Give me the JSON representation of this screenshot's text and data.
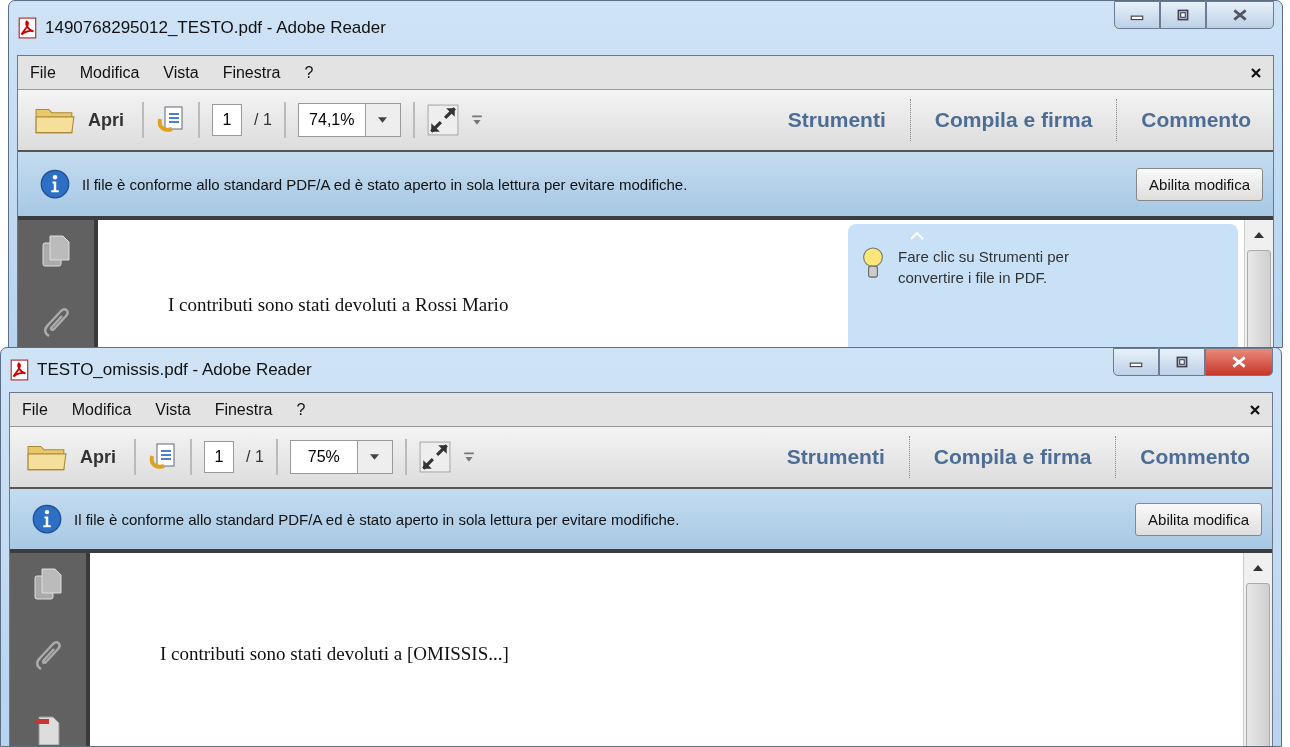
{
  "windows": [
    {
      "title": "1490768295012_TESTO.pdf - Adobe Reader",
      "focused": false,
      "menu": [
        "File",
        "Modifica",
        "Vista",
        "Finestra",
        "?"
      ],
      "toolbar": {
        "open": "Apri",
        "page": "1",
        "page_total": "/ 1",
        "zoom": "74,1%",
        "tools": [
          "Strumenti",
          "Compila e firma",
          "Commento"
        ]
      },
      "info_bar": {
        "message": "Il file è conforme allo standard PDF/A ed è stato aperto in sola lettura per evitare modifiche.",
        "button": "Abilita modifica"
      },
      "document": {
        "text": "I contributi sono stati devoluti a Rossi Mario"
      },
      "tooltip": {
        "text": "Fare clic su Strumenti per convertire i file in PDF."
      }
    },
    {
      "title": "TESTO_omissis.pdf - Adobe Reader",
      "focused": true,
      "menu": [
        "File",
        "Modifica",
        "Vista",
        "Finestra",
        "?"
      ],
      "toolbar": {
        "open": "Apri",
        "page": "1",
        "page_total": "/ 1",
        "zoom": "75%",
        "tools": [
          "Strumenti",
          "Compila e firma",
          "Commento"
        ]
      },
      "info_bar": {
        "message": "Il file è conforme allo standard PDF/A ed è stato aperto in sola lettura per evitare modifiche.",
        "button": "Abilita modifica"
      },
      "document": {
        "text": "I contributi sono stati devoluti a  [OMISSIS...]"
      }
    }
  ]
}
